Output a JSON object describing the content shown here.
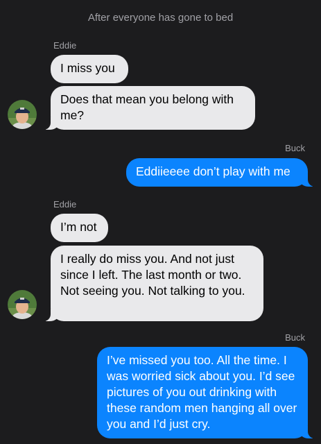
{
  "colors": {
    "background": "#1c1c1e",
    "incoming_bubble": "#e9e9eb",
    "incoming_text": "#000000",
    "outgoing_bubble": "#0b84fe",
    "outgoing_text": "#ffffff",
    "secondary_text": "#a1a1a6"
  },
  "conversation": {
    "timestamp": "After everyone has gone to bed",
    "groups": [
      {
        "sender": "Eddie",
        "direction": "incoming",
        "messages": [
          "I miss you",
          "Does that mean you belong with me?"
        ]
      },
      {
        "sender": "Buck",
        "direction": "outgoing",
        "messages": [
          "Eddiieeee don’t play with me"
        ]
      },
      {
        "sender": "Eddie",
        "direction": "incoming",
        "messages": [
          "I’m not",
          "I really do miss you. And not just since I left. The last month or two. Not seeing you. Not talking to you."
        ]
      },
      {
        "sender": "Buck",
        "direction": "outgoing",
        "messages": [
          "I’ve missed you too. All the time. I was worried sick about you. I’d see pictures of you out drinking with these random men hanging all over you and I’d just cry."
        ]
      }
    ]
  }
}
